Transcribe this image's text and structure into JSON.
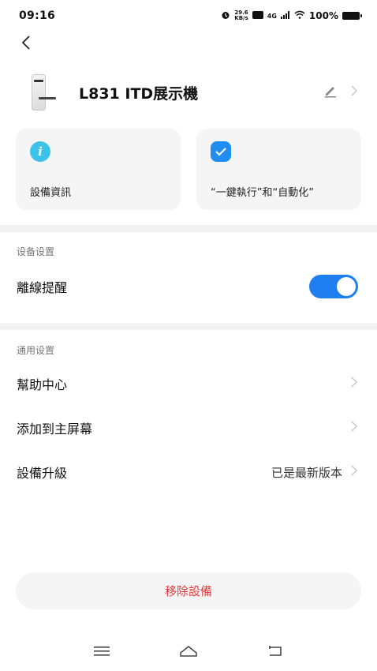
{
  "status_bar": {
    "time": "09:16",
    "speed_value": "29.6",
    "speed_unit": "KB/s",
    "network": "4G",
    "battery": "100%"
  },
  "device": {
    "name": "L831 ITD展示機"
  },
  "cards": [
    {
      "label": "設備資訊",
      "icon": "info-icon",
      "color": "#3ec3e8"
    },
    {
      "label": "“一鍵執行”和“自動化”",
      "icon": "check-icon",
      "color": "#1f8ef0"
    }
  ],
  "device_settings": {
    "title": "设备设置",
    "offline_reminder_label": "離線提醒",
    "offline_reminder_on": true
  },
  "general_settings": {
    "title": "通用设置",
    "items": [
      {
        "label": "幫助中心",
        "value": ""
      },
      {
        "label": "添加到主屏幕",
        "value": ""
      },
      {
        "label": "設備升級",
        "value": "已是最新版本"
      }
    ]
  },
  "remove_button": {
    "label": "移除設備",
    "color": "#e5393b"
  },
  "colors": {
    "accent": "#1f7ef0"
  }
}
